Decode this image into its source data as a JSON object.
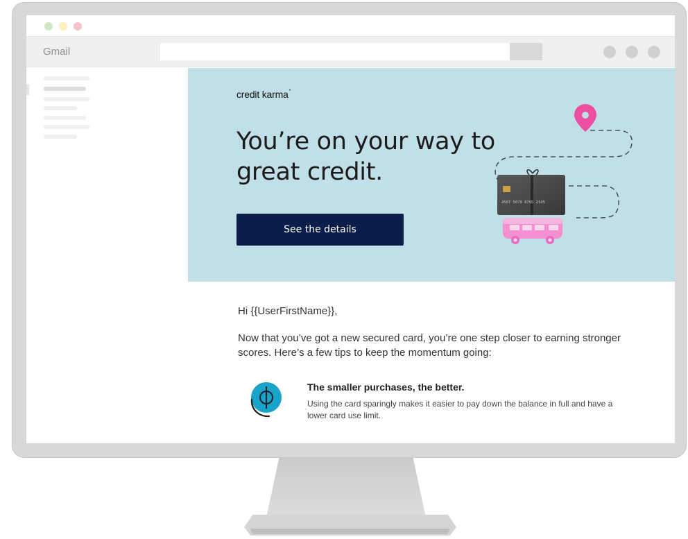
{
  "window": {
    "traffic_light_colors": [
      "#cde8c3",
      "#fbf2bd",
      "#f5c3c9"
    ],
    "app_name": "Gmail"
  },
  "toolbar": {
    "search_value": "",
    "icons": [
      "account-circle-icon",
      "settings-circle-icon",
      "apps-circle-icon"
    ]
  },
  "email": {
    "brand": "credit karma",
    "headline": "You’re on your way to great credit.",
    "cta_label": "See the details",
    "card_number": "4567 5678 8765 2345",
    "greeting": "Hi {{UserFirstName}},",
    "intro": "Now that you’ve got a new secured card, you’re one step closer to earning stronger scores. Here’s a few tips to keep the momentum going:",
    "tips": [
      {
        "icon": "cent-coin-icon",
        "title": "The smaller purchases, the better.",
        "text": "Using the card sparingly makes it easier to pay down the balance in full and have a lower card use limit."
      }
    ]
  },
  "colors": {
    "hero_background": "#c1dfe7",
    "cta_background": "#0b1d4b",
    "pin": "#ec4f9f",
    "van": "#f48fd1",
    "coin": "#1aa3c9"
  }
}
